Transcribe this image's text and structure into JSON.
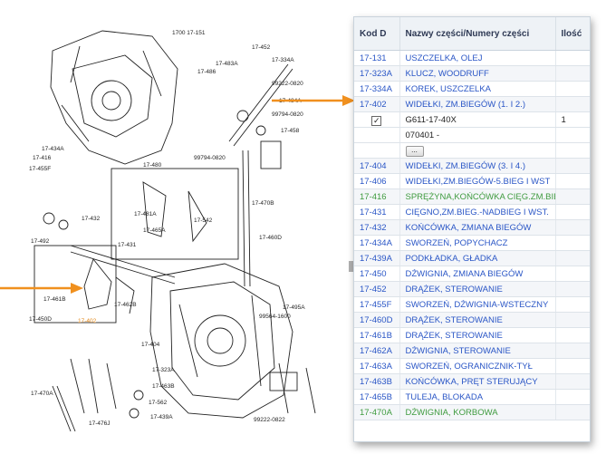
{
  "diagram": {
    "labels": [
      {
        "id": "l1700",
        "text": "1700 17-151"
      },
      {
        "id": "l17452a",
        "text": "17-452"
      },
      {
        "id": "l17334a",
        "text": "17-334A"
      },
      {
        "id": "l17483a",
        "text": "17-483A"
      },
      {
        "id": "l17486",
        "text": "17-486"
      },
      {
        "id": "l99222",
        "text": "99222-0820"
      },
      {
        "id": "l17484a",
        "text": "17-484A"
      },
      {
        "id": "l99794a",
        "text": "99794-0820"
      },
      {
        "id": "l17458",
        "text": "17-458"
      },
      {
        "id": "l17480",
        "text": "17-480"
      },
      {
        "id": "l99794b",
        "text": "99794-0820"
      },
      {
        "id": "l17434a",
        "text": "17-434A"
      },
      {
        "id": "l17416",
        "text": "17-416"
      },
      {
        "id": "l17455f",
        "text": "17-455F"
      },
      {
        "id": "l17432",
        "text": "17-432"
      },
      {
        "id": "l17492",
        "text": "17-492"
      },
      {
        "id": "l17431",
        "text": "17-431"
      },
      {
        "id": "l17481a",
        "text": "17-481A"
      },
      {
        "id": "l17465a",
        "text": "17-465A"
      },
      {
        "id": "l17542",
        "text": "17-542"
      },
      {
        "id": "l17470b",
        "text": "17-470B"
      },
      {
        "id": "l17460d",
        "text": "17-460D"
      },
      {
        "id": "l17461b",
        "text": "17-461B"
      },
      {
        "id": "l17450d",
        "text": "17-450D"
      },
      {
        "id": "l17402",
        "text": "17-402"
      },
      {
        "id": "l17462b",
        "text": "17-462B"
      },
      {
        "id": "l17495a",
        "text": "17-495A"
      },
      {
        "id": "l17404",
        "text": "17-404"
      },
      {
        "id": "l17323a",
        "text": "17-323A"
      },
      {
        "id": "l17463b",
        "text": "17-463B"
      },
      {
        "id": "l17439a",
        "text": "17-439A"
      },
      {
        "id": "l17476j",
        "text": "17-476J"
      },
      {
        "id": "l17470a",
        "text": "17-470A"
      },
      {
        "id": "l17562",
        "text": "17-562"
      },
      {
        "id": "l99564",
        "text": "99564-1600"
      },
      {
        "id": "l99222b",
        "text": "99222-0822"
      }
    ],
    "colors": {
      "lineart": "#222222",
      "highlight": "#e2891c",
      "arrow": "#f0901e"
    }
  },
  "table": {
    "headers": {
      "code": "Kod D",
      "name": "Nazwy części/Numery części",
      "qty": "Ilość"
    },
    "rows_before": [
      {
        "code": "17-131",
        "name": "USZCZELKA, OLEJ"
      },
      {
        "code": "17-323A",
        "name": "KLUCZ, WOODRUFF"
      },
      {
        "code": "17-334A",
        "name": "KOREK, USZCZELKA"
      },
      {
        "code": "17-402",
        "name": "WIDEŁKI, ZM.BIEGÓW (1. I 2.)"
      }
    ],
    "detail": {
      "part_number": "G611-17-40X",
      "qty": "1",
      "range": "070401  -",
      "more_button": "...",
      "checked": true
    },
    "rows_after": [
      {
        "code": "17-404",
        "name": "WIDEŁKI, ZM.BIEGÓW (3. I 4.)",
        "green": false
      },
      {
        "code": "17-406",
        "name": "WIDEŁKI,ZM.BIEGÓW-5.BIEG I WST",
        "green": false
      },
      {
        "code": "17-416",
        "name": "SPRĘŻYNA,KOŃCÓWKA CIĘG.ZM.BIEG",
        "green": true
      },
      {
        "code": "17-431",
        "name": "CIĘGNO,ZM.BIEG.-NADBIEG I WST.",
        "green": false
      },
      {
        "code": "17-432",
        "name": "KOŃCÓWKA, ZMIANA BIEGÓW",
        "green": false
      },
      {
        "code": "17-434A",
        "name": "SWORZEŃ, POPYCHACZ",
        "green": false
      },
      {
        "code": "17-439A",
        "name": "PODKŁADKA, GŁADKA",
        "green": false
      },
      {
        "code": "17-450",
        "name": "DŹWIGNIA, ZMIANA BIEGÓW",
        "green": false
      },
      {
        "code": "17-452",
        "name": "DRĄŻEK, STEROWANIE",
        "green": false
      },
      {
        "code": "17-455F",
        "name": "SWORZEŃ, DŹWIGNIA-WSTECZNY",
        "green": false
      },
      {
        "code": "17-460D",
        "name": "DRĄŻEK, STEROWANIE",
        "green": false
      },
      {
        "code": "17-461B",
        "name": "DRĄŻEK, STEROWANIE",
        "green": false
      },
      {
        "code": "17-462A",
        "name": "DŹWIGNIA, STEROWANIE",
        "green": false
      },
      {
        "code": "17-463A",
        "name": "SWORZEŃ, OGRANICZNIK-TYŁ",
        "green": false
      },
      {
        "code": "17-463B",
        "name": "KOŃCÓWKA, PRĘT STERUJĄCY",
        "green": false
      },
      {
        "code": "17-465B",
        "name": "TULEJA, BLOKADA",
        "green": false
      },
      {
        "code": "17-470A",
        "name": "DŹWIGNIA, KORBOWA",
        "green": true
      }
    ]
  }
}
